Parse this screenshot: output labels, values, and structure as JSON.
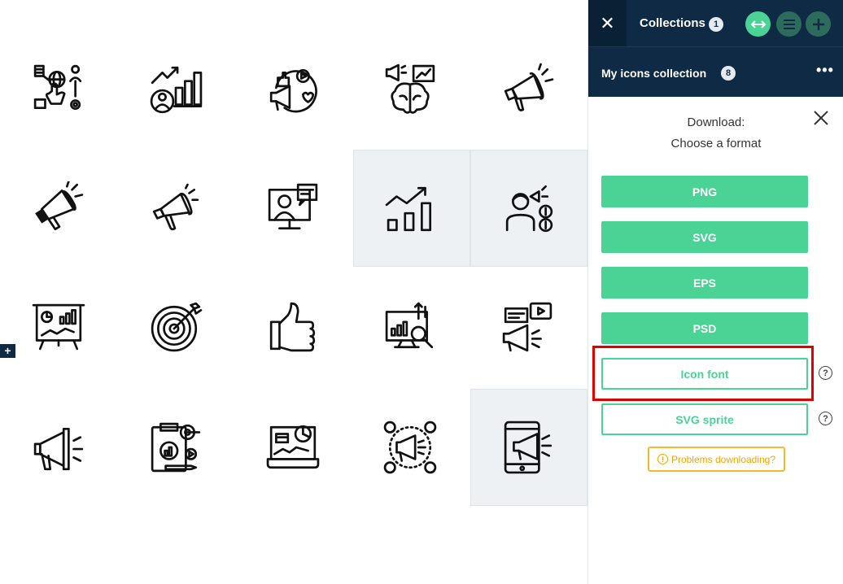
{
  "panel": {
    "collections_title": "Collections",
    "collections_count": "1",
    "collection_name": "My icons collection",
    "collection_count": "8",
    "more_label": "•••",
    "download_heading": "Download:",
    "download_subheading": "Choose a format",
    "formats": [
      {
        "label": "PNG"
      },
      {
        "label": "SVG"
      },
      {
        "label": "EPS"
      },
      {
        "label": "PSD"
      },
      {
        "label": "Icon font"
      },
      {
        "label": "SVG sprite"
      }
    ],
    "help_label": "?",
    "problems_label": "Problems downloading?",
    "problems_icon": "!"
  },
  "grid": {
    "side_plus_label": "+",
    "icons": [
      "digital-marketing-icon",
      "growth-chart-user-icon",
      "social-media-megaphone-icon",
      "brain-marketing-icon",
      "megaphone-icon",
      "megaphone-filled-icon",
      "megaphone-outline-icon",
      "video-call-icon",
      "bar-chart-growth-icon",
      "marketer-money-icon",
      "presentation-board-icon",
      "target-icon",
      "thumbs-up-icon",
      "analytics-monitor-icon",
      "social-chat-megaphone-icon",
      "megaphone-loud-icon",
      "report-clipboard-icon",
      "laptop-analytics-icon",
      "megaphone-network-icon",
      "tablet-megaphone-icon"
    ]
  },
  "colors": {
    "navy": "#0f2a44",
    "green": "#4bd396",
    "warning": "#f5b82e",
    "highlight": "#e00000"
  }
}
